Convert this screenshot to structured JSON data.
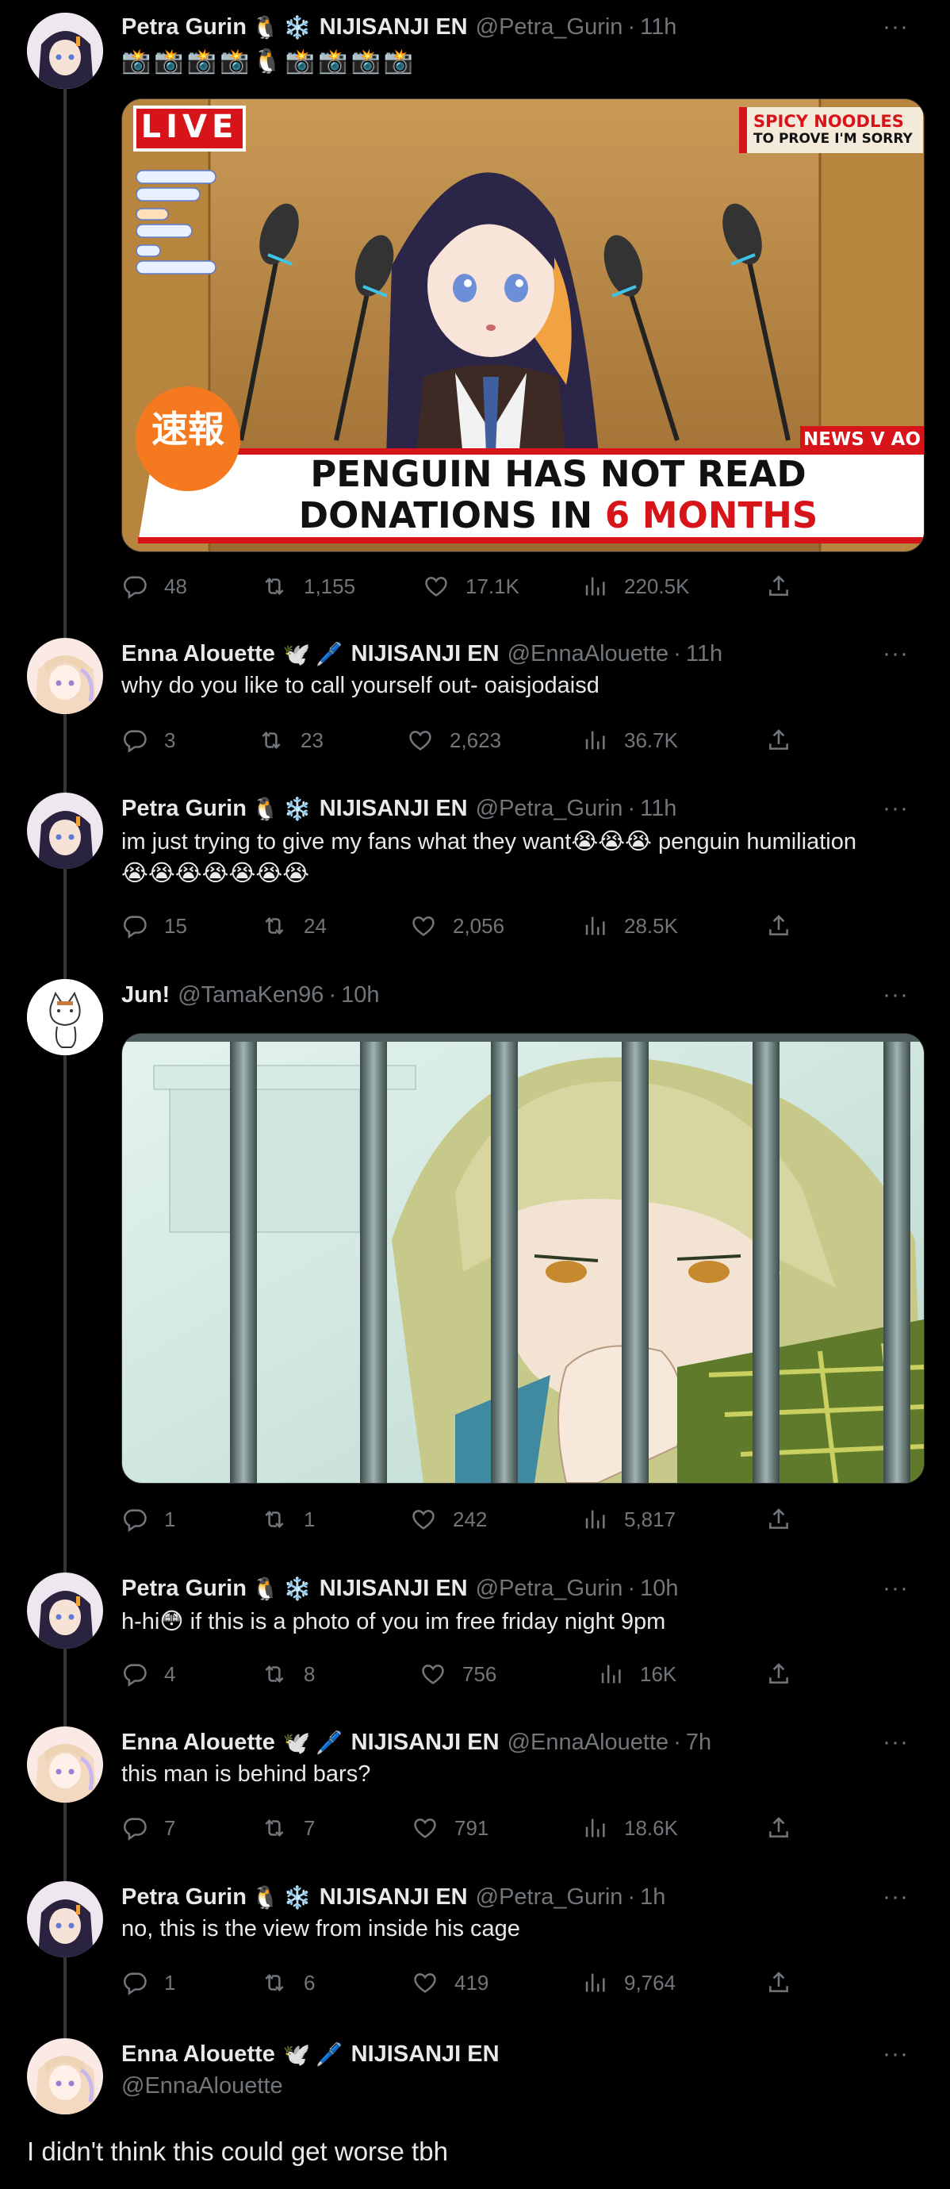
{
  "colors": {
    "background": "#000000",
    "text": "#e7e9ea",
    "muted": "#71767b",
    "news_red": "#d7141a",
    "accent_orange": "#f57a1f"
  },
  "tweets": [
    {
      "name": "Petra Gurin",
      "badges": "NIJISANJI EN",
      "handle": "@Petra_Gurin",
      "time": "11h",
      "text": "",
      "emoji_line": "📸📸📸📸🐧📸📸📸📸",
      "media": {
        "live": "LIVE",
        "corner_line1": "SPICY NOODLES",
        "corner_line2": "TO PROVE I'M SORRY",
        "stamp": "速報",
        "tag": "NEWS V AO",
        "headline1": "PENGUIN HAS NOT READ",
        "headline2_a": "DONATIONS IN ",
        "headline2_b": "6 MONTHS"
      },
      "stats": {
        "replies": "48",
        "retweets": "1,155",
        "likes": "17.1K",
        "views": "220.5K"
      }
    },
    {
      "name": "Enna Alouette",
      "badges": "NIJISANJI EN",
      "handle": "@EnnaAlouette",
      "time": "11h",
      "text": "why do you like to call yourself out- oaisjodaisd",
      "stats": {
        "replies": "3",
        "retweets": "23",
        "likes": "2,623",
        "views": "36.7K"
      }
    },
    {
      "name": "Petra Gurin",
      "badges": "NIJISANJI EN",
      "handle": "@Petra_Gurin",
      "time": "11h",
      "text": "im just trying to give my fans what they want😭😭😭 penguin humiliation",
      "text2": "😭😭😭😭😭😭😭",
      "stats": {
        "replies": "15",
        "retweets": "24",
        "likes": "2,056",
        "views": "28.5K"
      }
    },
    {
      "name": "Jun!",
      "badges": "",
      "handle": "@TamaKen96",
      "time": "10h",
      "text": "",
      "stats": {
        "replies": "1",
        "retweets": "1",
        "likes": "242",
        "views": "5,817"
      }
    },
    {
      "name": "Petra Gurin",
      "badges": "NIJISANJI EN",
      "handle": "@Petra_Gurin",
      "time": "10h",
      "text": "h-hi😳 if this is a photo of you im free friday night 9pm",
      "stats": {
        "replies": "4",
        "retweets": "8",
        "likes": "756",
        "views": "16K"
      }
    },
    {
      "name": "Enna Alouette",
      "badges": "NIJISANJI EN",
      "handle": "@EnnaAlouette",
      "time": "7h",
      "text": "this man is behind bars?",
      "stats": {
        "replies": "7",
        "retweets": "7",
        "likes": "791",
        "views": "18.6K"
      }
    },
    {
      "name": "Petra Gurin",
      "badges": "NIJISANJI EN",
      "handle": "@Petra_Gurin",
      "time": "1h",
      "text": "no, this is the view from inside his cage",
      "stats": {
        "replies": "1",
        "retweets": "6",
        "likes": "419",
        "views": "9,764"
      }
    }
  ],
  "main": {
    "name": "Enna Alouette",
    "badges": "NIJISANJI EN",
    "handle": "@EnnaAlouette",
    "text": "I didn't think this could get worse tbh"
  },
  "dot": "·",
  "more": "···",
  "icons": {
    "reply": "reply-icon",
    "retweet": "retweet-icon",
    "like": "heart-icon",
    "views": "views-icon",
    "share": "share-icon"
  }
}
